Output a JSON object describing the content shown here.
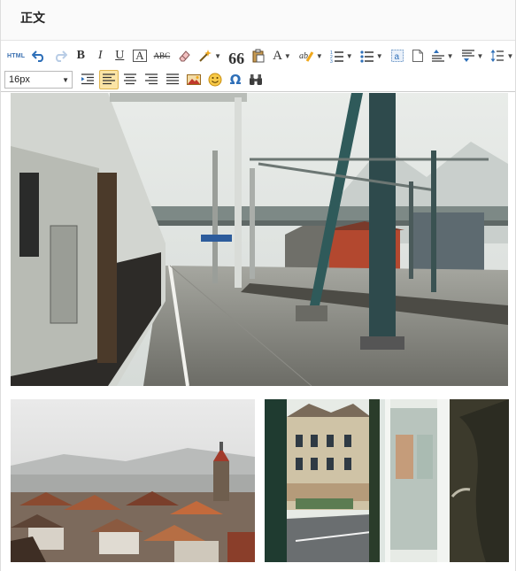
{
  "header": {
    "title": "正文"
  },
  "toolbar": {
    "row1": [
      {
        "name": "html-source-button",
        "icon": "html-icon",
        "label": "HTML"
      },
      {
        "name": "undo-button",
        "icon": "undo-icon"
      },
      {
        "name": "redo-button",
        "icon": "redo-icon"
      },
      {
        "name": "bold-button",
        "icon": "bold-icon",
        "label": "B"
      },
      {
        "name": "italic-button",
        "icon": "italic-icon",
        "label": "I"
      },
      {
        "name": "underline-button",
        "icon": "underline-icon",
        "label": "U"
      },
      {
        "name": "font-border-button",
        "icon": "font-border-icon",
        "label": "A"
      },
      {
        "name": "strikethrough-button",
        "icon": "strikethrough-icon",
        "label": "ABC"
      },
      {
        "name": "eraser-button",
        "icon": "eraser-icon"
      },
      {
        "name": "format-painter-button",
        "icon": "magic-wand-icon",
        "dropdown": true
      },
      {
        "name": "blockquote-button",
        "icon": "quote-icon",
        "label": "66"
      },
      {
        "name": "paste-plain-button",
        "icon": "paste-icon"
      },
      {
        "name": "font-color-button",
        "icon": "font-color-icon",
        "label": "A",
        "dropdown": true
      },
      {
        "name": "highlight-button",
        "icon": "highlight-icon",
        "label": "ab",
        "dropdown": true
      },
      {
        "name": "ordered-list-button",
        "icon": "ordered-list-icon",
        "dropdown": true
      },
      {
        "name": "unordered-list-button",
        "icon": "unordered-list-icon",
        "dropdown": true
      },
      {
        "name": "select-all-button",
        "icon": "select-all-icon"
      },
      {
        "name": "clear-doc-button",
        "icon": "blank-doc-icon"
      },
      {
        "name": "paragraph-spacing-top-button",
        "icon": "row-spacing-top-icon",
        "dropdown": true
      },
      {
        "name": "paragraph-spacing-bottom-button",
        "icon": "row-spacing-bottom-icon",
        "dropdown": true
      },
      {
        "name": "line-height-button",
        "icon": "line-height-icon",
        "dropdown": true
      }
    ],
    "fontsize": {
      "value": "16px"
    },
    "row2": [
      {
        "name": "indent-button",
        "icon": "indent-icon"
      },
      {
        "name": "align-left-button",
        "icon": "align-left-icon",
        "active": true
      },
      {
        "name": "align-center-button",
        "icon": "align-center-icon"
      },
      {
        "name": "align-right-button",
        "icon": "align-right-icon"
      },
      {
        "name": "align-justify-button",
        "icon": "align-justify-icon"
      },
      {
        "name": "insert-image-button",
        "icon": "image-icon"
      },
      {
        "name": "emoticon-button",
        "icon": "emoticon-icon"
      },
      {
        "name": "special-chars-button",
        "icon": "omega-icon",
        "label": "Ω"
      },
      {
        "name": "search-replace-button",
        "icon": "binoculars-icon"
      }
    ]
  },
  "content": {
    "photos": [
      {
        "name": "photo-train-platform",
        "subject": "train station platform"
      },
      {
        "name": "photo-city-rooftops",
        "subject": "city rooftops"
      },
      {
        "name": "photo-window-street",
        "subject": "street view through open window"
      }
    ]
  },
  "colors": {
    "accent": "#3a6fb0",
    "active_bg": "#fbe4a6",
    "active_border": "#e0b650",
    "header_bg": "#fafafa"
  }
}
